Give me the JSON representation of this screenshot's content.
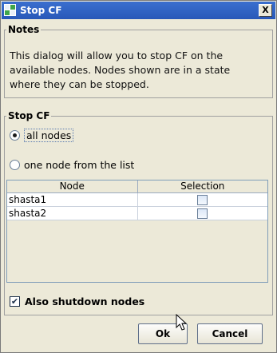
{
  "window": {
    "title": "Stop CF",
    "close_glyph": "X"
  },
  "notes": {
    "legend": "Notes",
    "lines": [
      "This dialog will allow you to stop CF on the",
      "available nodes.  Nodes shown are in a state",
      "where they can be stopped."
    ]
  },
  "stop_cf": {
    "legend": "Stop CF",
    "options": [
      {
        "label": "all nodes",
        "selected": true
      },
      {
        "label": "one node from the list",
        "selected": false
      }
    ],
    "table": {
      "columns": [
        "Node",
        "Selection"
      ],
      "rows": [
        {
          "node": "shasta1",
          "selected": false
        },
        {
          "node": "shasta2",
          "selected": false
        }
      ]
    },
    "also_shutdown": {
      "label": "Also shutdown nodes",
      "checked": true
    }
  },
  "buttons": {
    "ok": "Ok",
    "cancel": "Cancel"
  },
  "icons": {
    "app": "app-icon",
    "close": "close-icon",
    "cursor": "mouse-cursor-icon"
  }
}
